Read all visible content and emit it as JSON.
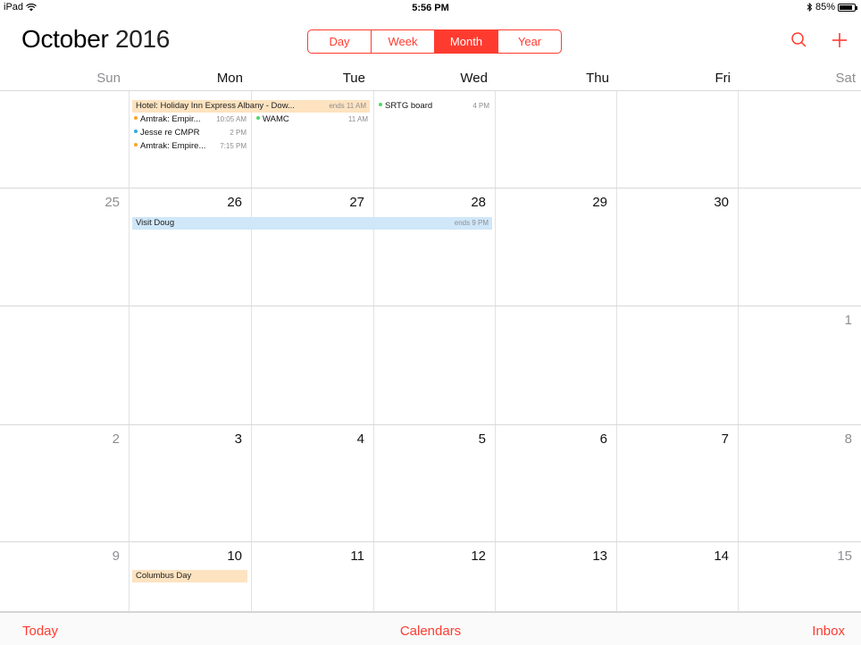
{
  "status": {
    "device": "iPad",
    "time": "5:56 PM",
    "battery": "85%",
    "battery_level": 0.85
  },
  "header": {
    "month": "October",
    "year": "2016"
  },
  "view_tabs": [
    {
      "label": "Day",
      "active": false
    },
    {
      "label": "Week",
      "active": false
    },
    {
      "label": "Month",
      "active": true
    },
    {
      "label": "Year",
      "active": false
    }
  ],
  "weekdays": [
    "Sun",
    "Mon",
    "Tue",
    "Wed",
    "Thu",
    "Fri",
    "Sat"
  ],
  "weeks": [
    {
      "days": [
        "",
        "",
        "",
        "",
        "",
        "",
        ""
      ]
    },
    {
      "days": [
        "25",
        "26",
        "27",
        "28",
        "29",
        "30",
        ""
      ]
    },
    {
      "days": [
        "",
        "",
        "",
        "",
        "",
        "",
        "1"
      ]
    },
    {
      "days": [
        "2",
        "3",
        "4",
        "5",
        "6",
        "7",
        "8"
      ]
    },
    {
      "days": [
        "9",
        "10",
        "11",
        "12",
        "13",
        "14",
        "15"
      ]
    }
  ],
  "events": {
    "hotel": {
      "title": "Hotel: Holiday Inn Express Albany - Dow...",
      "ends": "ends 11 AM",
      "color": "#fde3c0"
    },
    "amtrak1": {
      "title": "Amtrak: Empir...",
      "time": "10:05 AM",
      "dot": "#f5a623"
    },
    "jesse": {
      "title": "Jesse re CMPR",
      "time": "2 PM",
      "dot": "#34aadc"
    },
    "amtrak2": {
      "title": "Amtrak: Empire...",
      "time": "7:15 PM",
      "dot": "#f5a623"
    },
    "wamc": {
      "title": "WAMC",
      "time": "11 AM",
      "dot": "#4cd964"
    },
    "srtg": {
      "title": "SRTG board",
      "time": "4 PM",
      "dot": "#4cd964"
    },
    "visit": {
      "title": "Visit Doug",
      "ends": "ends 9 PM",
      "color": "#cfe7f9"
    },
    "columbus": {
      "title": "Columbus Day",
      "color": "#fde3c0"
    }
  },
  "toolbar": {
    "today": "Today",
    "calendars": "Calendars",
    "inbox": "Inbox"
  },
  "colors": {
    "accent": "#ff3b30",
    "weekend_text": "#8e8e93"
  }
}
